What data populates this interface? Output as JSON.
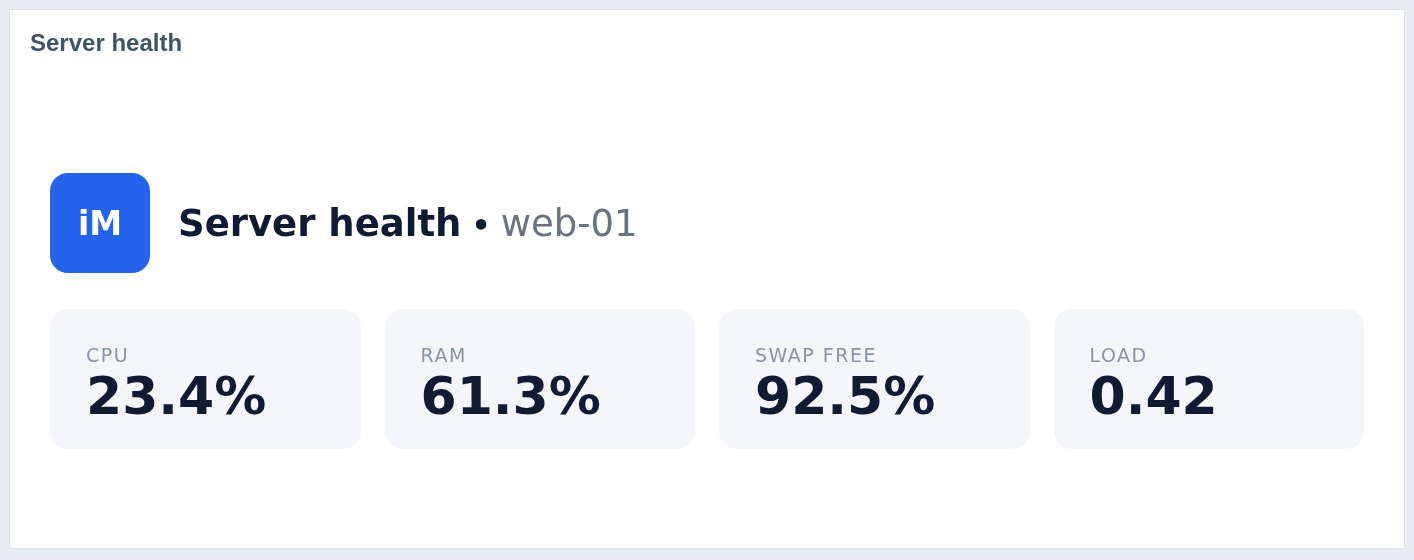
{
  "panel": {
    "title": "Server health"
  },
  "header": {
    "logo": "iM",
    "title": "Server health",
    "separator": "•",
    "host": "web-01"
  },
  "metrics": [
    {
      "label": "CPU",
      "value": "23.4%"
    },
    {
      "label": "RAM",
      "value": "61.3%"
    },
    {
      "label": "SWAP FREE",
      "value": "92.5%"
    },
    {
      "label": "LOAD",
      "value": "0.42"
    }
  ]
}
